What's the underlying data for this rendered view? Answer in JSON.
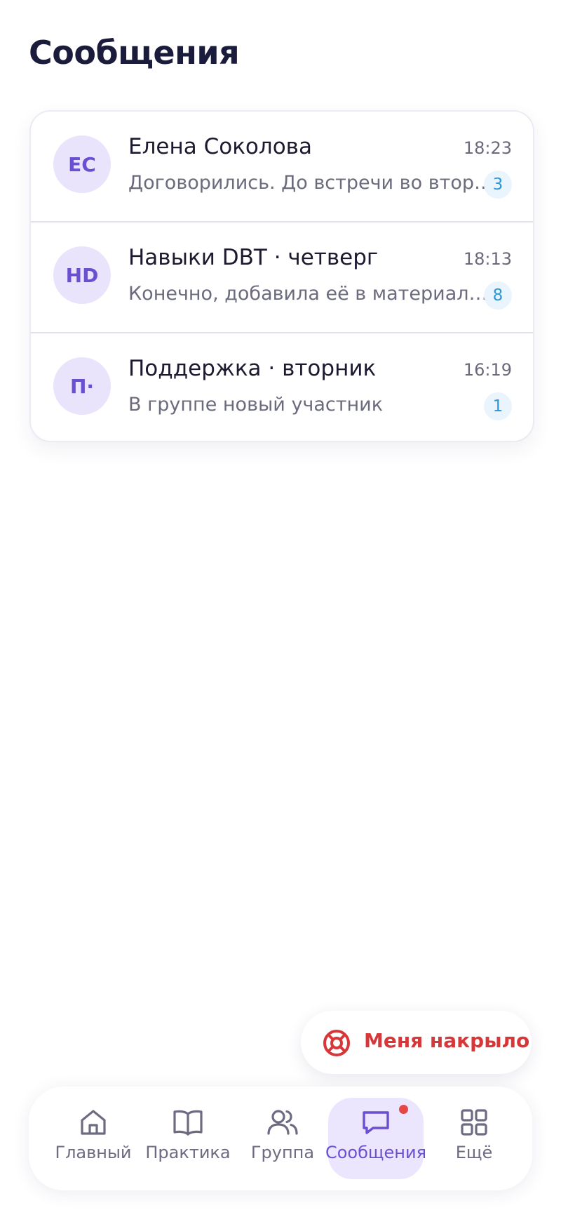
{
  "page": {
    "title": "Сообщения"
  },
  "chats": [
    {
      "initials": "ЕС",
      "name": "Елена Соколова",
      "time": "18:23",
      "preview": "Договорились. До встречи во вторник",
      "unread": "3"
    },
    {
      "initials": "HD",
      "name": "Навыки DBT · четверг",
      "time": "18:13",
      "preview": "Конечно, добавила её в материалы группы",
      "unread": "8"
    },
    {
      "initials": "П·",
      "name": "Поддержка · вторник",
      "time": "16:19",
      "preview": "В группе новый участник",
      "unread": "1"
    }
  ],
  "crisis": {
    "label": "Меня накрыло",
    "icon": "lifebuoy-icon",
    "color": "#d8373a"
  },
  "nav": {
    "items": [
      {
        "label": "Главный",
        "icon": "home-icon"
      },
      {
        "label": "Практика",
        "icon": "book-icon"
      },
      {
        "label": "Группа",
        "icon": "users-icon"
      },
      {
        "label": "Сообщения",
        "icon": "chat-icon",
        "active": true,
        "has_notification": true
      },
      {
        "label": "Ещё",
        "icon": "grid-icon"
      }
    ]
  },
  "colors": {
    "accent": "#6a4fd1",
    "accent_bg": "#ebe6fd",
    "avatar_bg": "#e9e4fb",
    "badge_text": "#2b97d8",
    "badge_bg": "#eaf4fd",
    "notification_dot": "#e74646"
  }
}
